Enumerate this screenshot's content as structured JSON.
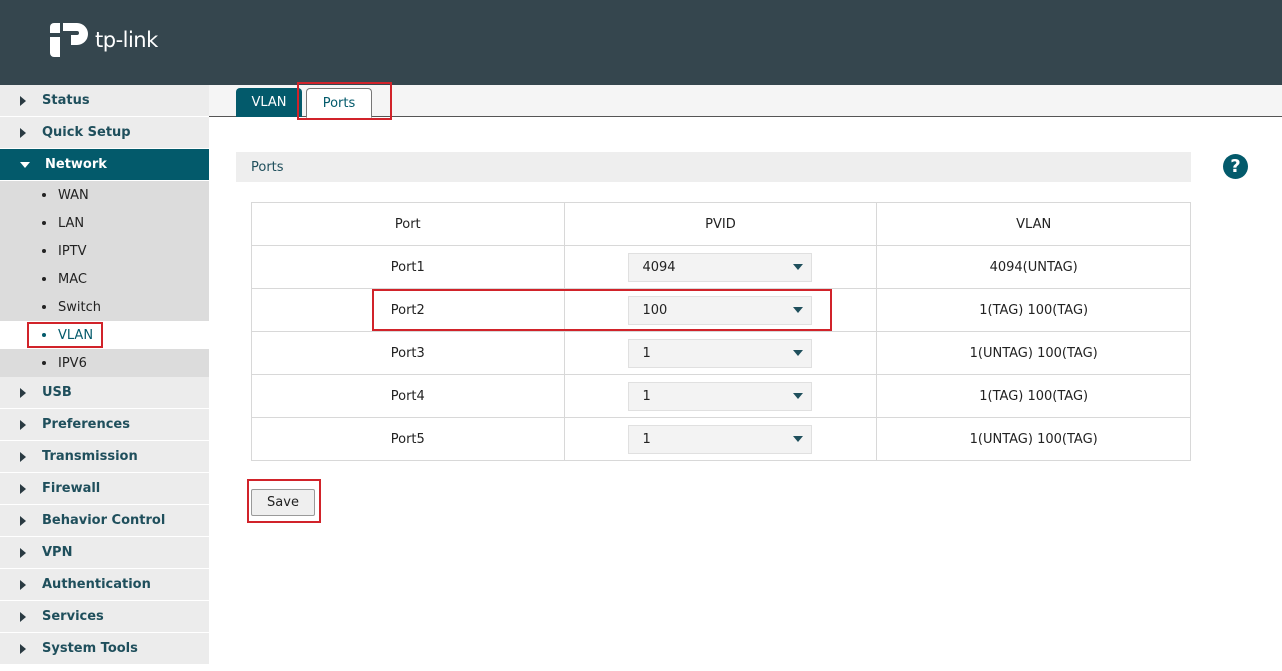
{
  "header": {
    "brand": "tp-link"
  },
  "sidebar": {
    "items": [
      {
        "label": "Status"
      },
      {
        "label": "Quick Setup"
      },
      {
        "label": "Network",
        "sub": [
          "WAN",
          "LAN",
          "IPTV",
          "MAC",
          "Switch",
          "VLAN",
          "IPV6"
        ],
        "active_sub": "VLAN"
      },
      {
        "label": "USB"
      },
      {
        "label": "Preferences"
      },
      {
        "label": "Transmission"
      },
      {
        "label": "Firewall"
      },
      {
        "label": "Behavior Control"
      },
      {
        "label": "VPN"
      },
      {
        "label": "Authentication"
      },
      {
        "label": "Services"
      },
      {
        "label": "System Tools"
      }
    ]
  },
  "tabs": [
    {
      "label": "VLAN"
    },
    {
      "label": "Ports"
    }
  ],
  "section": {
    "title": "Ports"
  },
  "table": {
    "headers": [
      "Port",
      "PVID",
      "VLAN"
    ],
    "rows": [
      {
        "port": "Port1",
        "pvid": "4094",
        "vlan": "4094(UNTAG)"
      },
      {
        "port": "Port2",
        "pvid": "100",
        "vlan": "1(TAG) 100(TAG)"
      },
      {
        "port": "Port3",
        "pvid": "1",
        "vlan": "1(UNTAG) 100(TAG)"
      },
      {
        "port": "Port4",
        "pvid": "1",
        "vlan": "1(TAG) 100(TAG)"
      },
      {
        "port": "Port5",
        "pvid": "1",
        "vlan": "1(UNTAG) 100(TAG)"
      }
    ]
  },
  "actions": {
    "save_label": "Save"
  },
  "help": {
    "icon": "question-mark-icon",
    "glyph": "?"
  },
  "colors": {
    "header_bg": "#35464e",
    "accent": "#035a6b",
    "highlight": "#d1232a"
  }
}
